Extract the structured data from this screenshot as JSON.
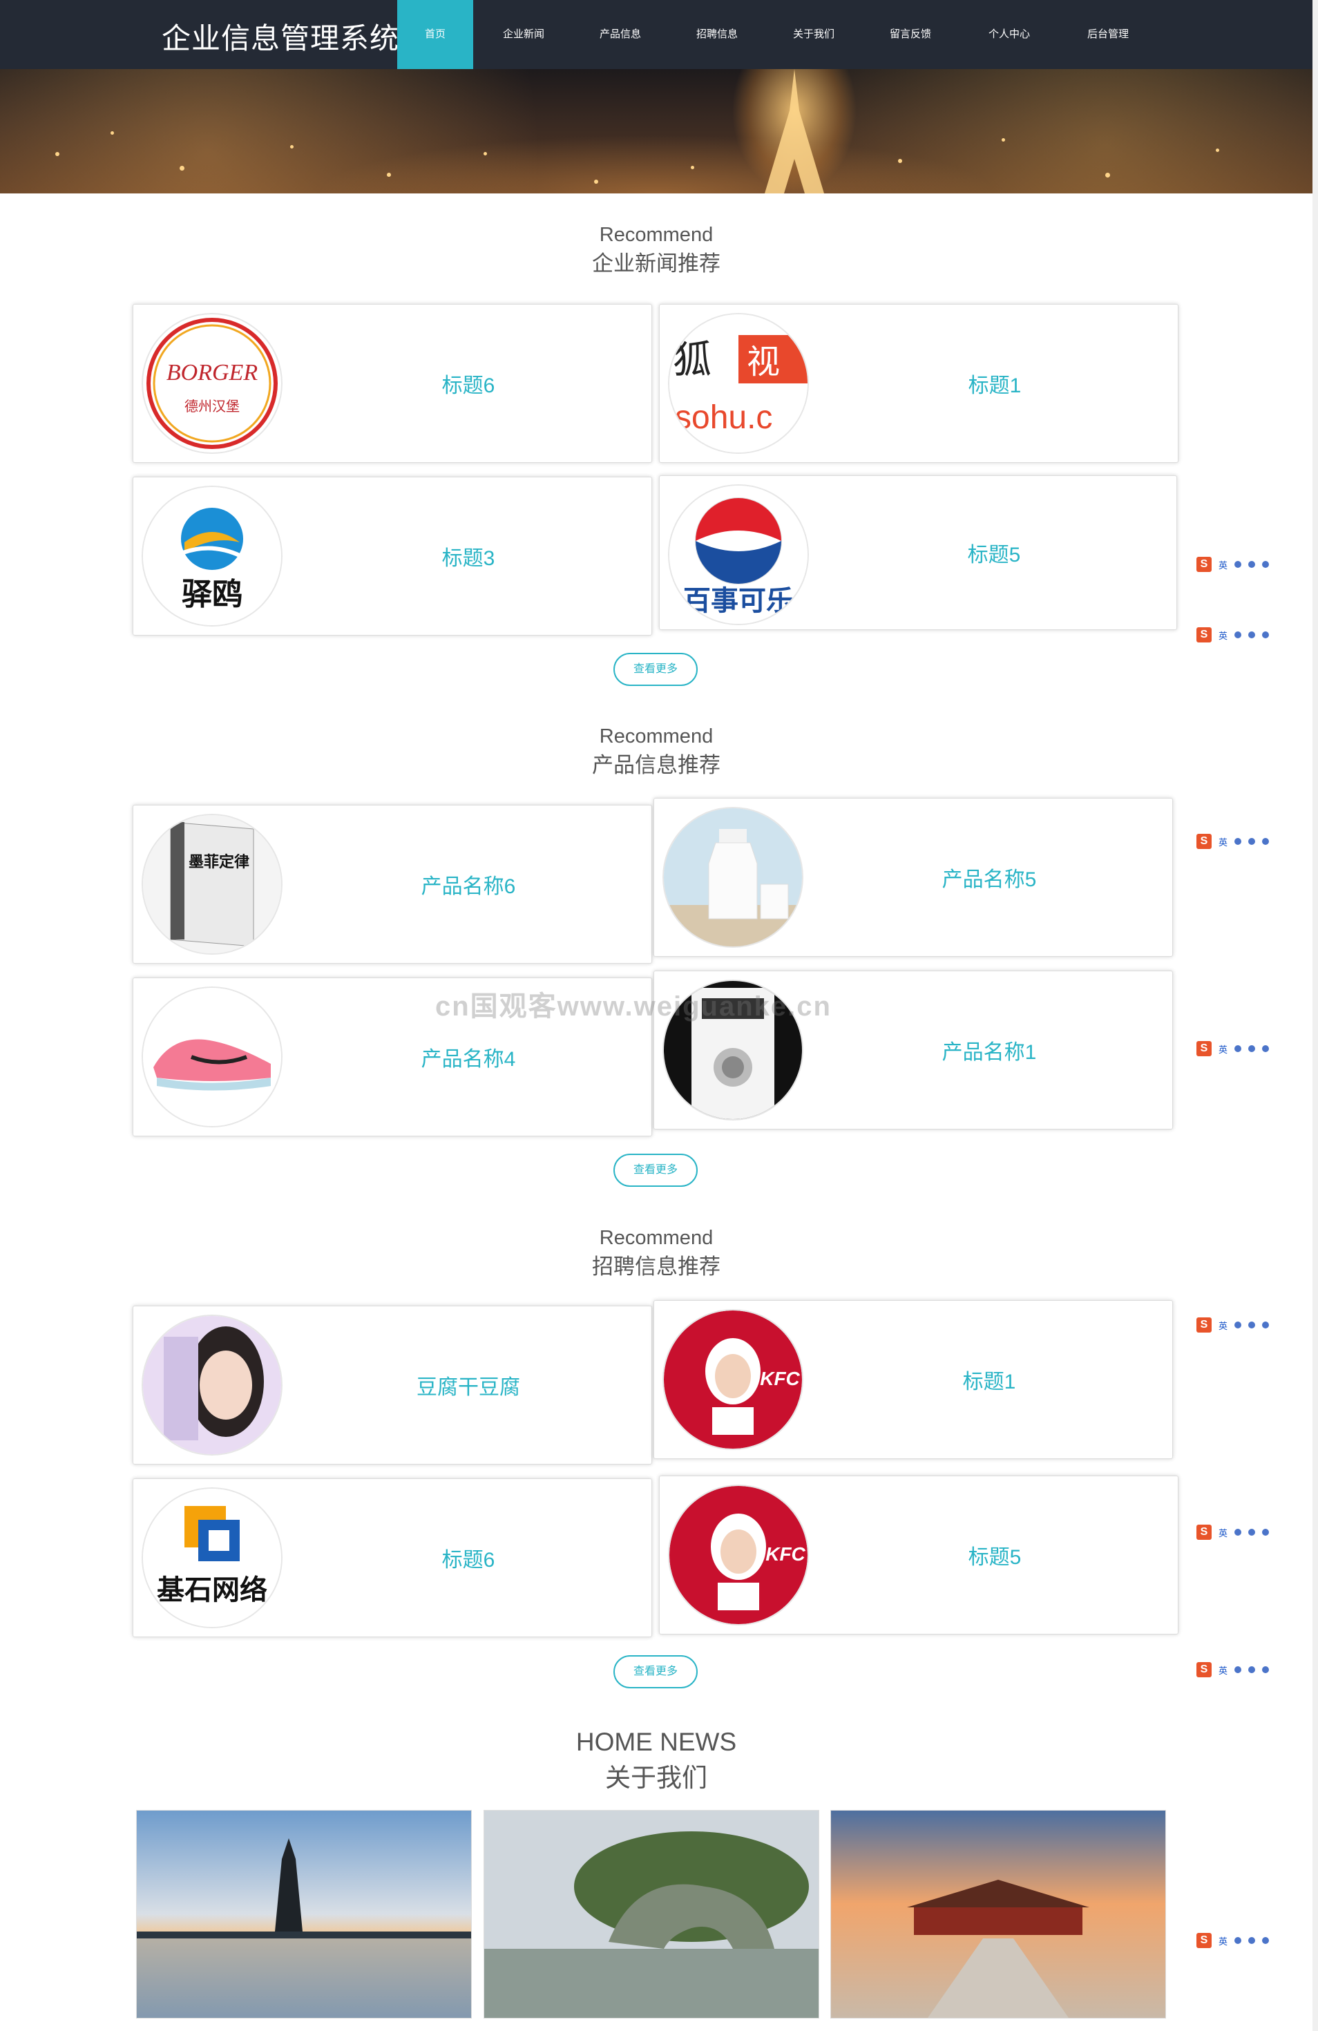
{
  "brand": "企业信息管理系统",
  "nav": [
    "首页",
    "企业新闻",
    "产品信息",
    "招聘信息",
    "关于我们",
    "留言反馈",
    "个人中心",
    "后台管理"
  ],
  "sections": [
    {
      "en": "Recommend",
      "cn": "企业新闻推荐",
      "more": "查看更多",
      "items": [
        {
          "title": "标题6",
          "image": "texas-burger-logo",
          "logo_text": "德州汉堡"
        },
        {
          "title": "标题1",
          "image": "sohu-video-logo",
          "logo_text": "sohu.c"
        },
        {
          "title": "标题3",
          "image": "yiou-logo",
          "logo_text": "驿鸥"
        },
        {
          "title": "标题5",
          "image": "pepsi-logo",
          "logo_text": "百事可乐"
        }
      ]
    },
    {
      "en": "Recommend",
      "cn": "产品信息推荐",
      "more": "查看更多",
      "items": [
        {
          "title": "产品名称6",
          "image": "book-murphys-law",
          "logo_text": "墨菲定律"
        },
        {
          "title": "产品名称5",
          "image": "milk-bottle"
        },
        {
          "title": "产品名称4",
          "image": "pink-sneaker"
        },
        {
          "title": "产品名称1",
          "image": "book-cover"
        }
      ]
    },
    {
      "en": "Recommend",
      "cn": "招聘信息推荐",
      "more": "查看更多",
      "items": [
        {
          "title": "豆腐干豆腐",
          "image": "woman-portrait"
        },
        {
          "title": "标题1",
          "image": "kfc-logo",
          "logo_text": "KFC"
        },
        {
          "title": "标题6",
          "image": "jishi-network-logo",
          "logo_text": "基石网络"
        },
        {
          "title": "标题5",
          "image": "kfc-logo",
          "logo_text": "KFC"
        }
      ]
    }
  ],
  "about": {
    "en": "HOME NEWS",
    "cn": "关于我们",
    "images": [
      "pagoda-lake",
      "elephant-trunk-hill",
      "forbidden-city"
    ]
  },
  "watermark": "cn国观客www.weiguanke.cn",
  "ime": {
    "logo": "S",
    "label": "英"
  }
}
